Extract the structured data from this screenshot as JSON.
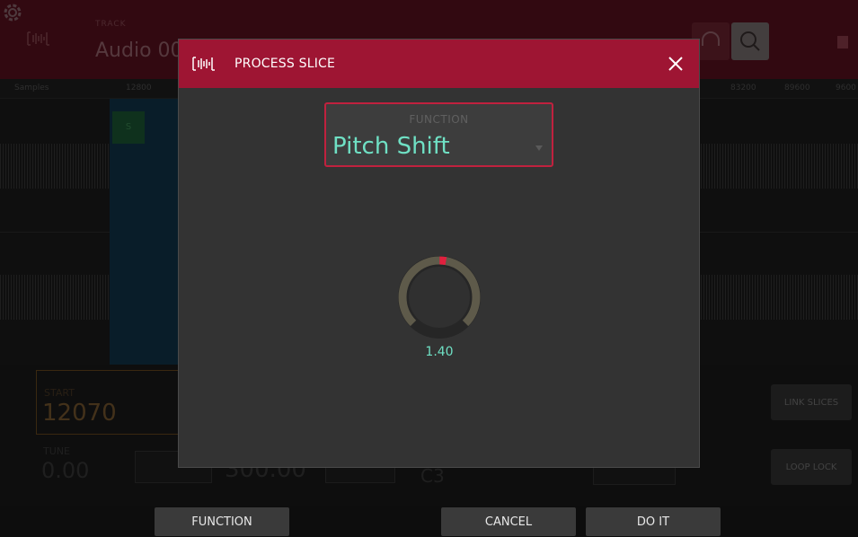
{
  "app": {
    "track_label": "TRACK",
    "track_name": "Audio 002",
    "ruler_labels": [
      "Samples",
      "12800",
      "83200",
      "89600",
      "9600"
    ]
  },
  "params": {
    "start_label": "START",
    "start_value": "12070",
    "tune_label": "TUNE",
    "tune_value": "0.00",
    "bpm_value": "300.00",
    "note_value": "C3",
    "link_slices_label": "LINK SLICES",
    "loop_lock_label": "LOOP LOCK"
  },
  "dialog": {
    "title": "PROCESS SLICE",
    "function_label": "FUNCTION",
    "function_value": "Pitch Shift",
    "knob_value": "1.40",
    "knob_level": 0.52
  },
  "bottom_bar": {
    "function_label": "FUNCTION",
    "cancel_label": "CANCEL",
    "do_it_label": "DO IT"
  },
  "colors": {
    "header": "#9e1533",
    "accent": "#6fe0c4",
    "knob_indicator": "#e0203e"
  },
  "icons": [
    "waveform-logo-icon",
    "close-icon",
    "headphones-icon",
    "zoom-icon",
    "gear-icon",
    "cpu-icon"
  ]
}
